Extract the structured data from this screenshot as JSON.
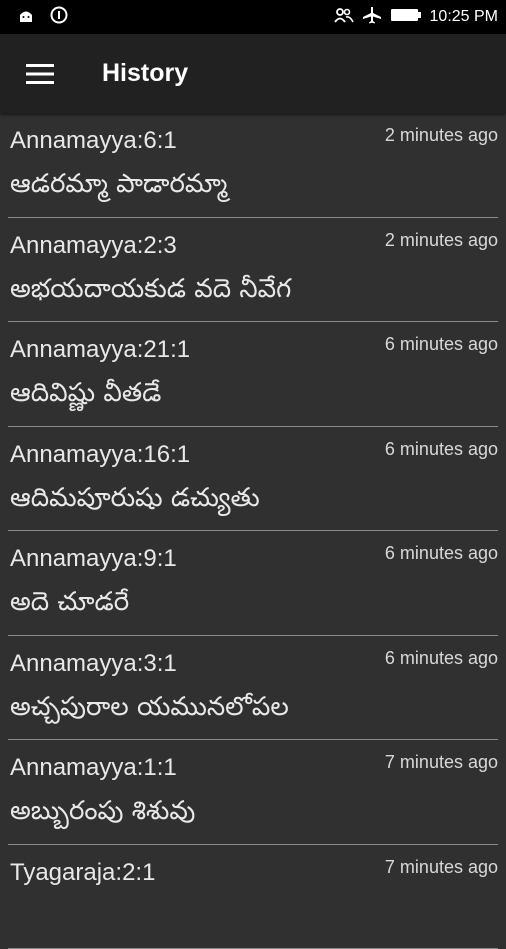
{
  "status_bar": {
    "time": "10:25 PM",
    "icons": [
      "android-debug-icon",
      "info-circle-icon",
      "people-icon",
      "airplane-icon",
      "battery-icon"
    ]
  },
  "app_bar": {
    "title": "History",
    "menu_icon": "hamburger-menu-icon"
  },
  "history": [
    {
      "title": "Annamayya:6:1",
      "subtitle": "ఆడరమ్మా పాడారమ్మా",
      "time": "2 minutes ago"
    },
    {
      "title": "Annamayya:2:3",
      "subtitle": "అభయదాయకుడ వదె నీవేగ",
      "time": "2 minutes ago"
    },
    {
      "title": "Annamayya:21:1",
      "subtitle": "ఆదివిష్ణు వీతడే",
      "time": "6 minutes ago"
    },
    {
      "title": "Annamayya:16:1",
      "subtitle": "ఆదిమపూరుషు డచ్యుతు",
      "time": "6 minutes ago"
    },
    {
      "title": "Annamayya:9:1",
      "subtitle": "అదె చూడరే",
      "time": "6 minutes ago"
    },
    {
      "title": "Annamayya:3:1",
      "subtitle": "అచ్చపురాల యమునలోపల",
      "time": "6 minutes ago"
    },
    {
      "title": "Annamayya:1:1",
      "subtitle": "అబ్బురంపు శిశువు",
      "time": "7 minutes ago"
    },
    {
      "title": "Tyagaraja:2:1",
      "subtitle": "",
      "time": "7 minutes ago"
    }
  ],
  "colors": {
    "status_bar_bg": "#000000",
    "app_bar_bg": "#212121",
    "list_bg": "#303030",
    "divider": "#8a8a8a"
  }
}
